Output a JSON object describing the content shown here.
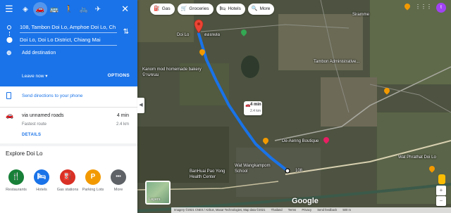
{
  "panel": {
    "modes": [
      "best-route",
      "drive",
      "transit",
      "walk",
      "cycle",
      "flight"
    ],
    "origin": "108, Tambon Doi Lo, Amphoe Doi Lo, Ch",
    "destination": "Doi Lo, Doi Lo District, Chiang Mai",
    "add_destination": "Add destination",
    "leave_now": "Leave now ▾",
    "options": "OPTIONS",
    "send_directions": "Send directions to your phone",
    "route": {
      "via": "via unnamed roads",
      "time": "4 min",
      "subtitle": "Fastest route",
      "distance": "2.4 km",
      "details": "DETAILS"
    },
    "explore_title": "Explore Doi Lo",
    "explore_items": [
      {
        "label": "Restaurants",
        "color": "#188038",
        "glyph": "🍴"
      },
      {
        "label": "Hotels",
        "color": "#1a73e8",
        "glyph": "🛏"
      },
      {
        "label": "Gas stations",
        "color": "#d93025",
        "glyph": "⛽"
      },
      {
        "label": "Parking Lots",
        "color": "#f29900",
        "glyph": "P"
      },
      {
        "label": "More",
        "color": "#5f6368",
        "glyph": "•••"
      }
    ]
  },
  "chips": [
    {
      "icon": "gas-icon",
      "glyph": "⛽",
      "label": "Gas"
    },
    {
      "icon": "cart-icon",
      "glyph": "🛒",
      "label": "Groceries"
    },
    {
      "icon": "bed-icon",
      "glyph": "🛏",
      "label": "Hotels"
    },
    {
      "icon": "search-icon",
      "glyph": "🔍",
      "label": "More"
    }
  ],
  "map": {
    "tooltip_time": "4 min",
    "tooltip_distance": "2.4 km",
    "avatar_letter": "t",
    "layers_label": "Layers",
    "google": "Google",
    "attribution": [
      "Imagery ©2021 CNES / Airbus, Maxar Technologies, Map data ©2021",
      "Thailand",
      "Terms",
      "Privacy",
      "Send feedback",
      "500 m"
    ],
    "labels": {
      "doi_lo": "Doi Lo",
      "doi_lo_thai": "ดอยหล่อ",
      "kanom": "Kanom mod homemade bakery บ้านขนม",
      "tambon": "Tambon Administrative...",
      "siramme": "Siramme",
      "de_aenng": "De-Aenng Boutique",
      "wat_wang": "Wat Wangkampom School",
      "banhuai": "BanHuai Pao Yong Health Center",
      "wat_phrathat": "Wat Phrathat Doi Lo",
      "dest_108": "108"
    }
  }
}
